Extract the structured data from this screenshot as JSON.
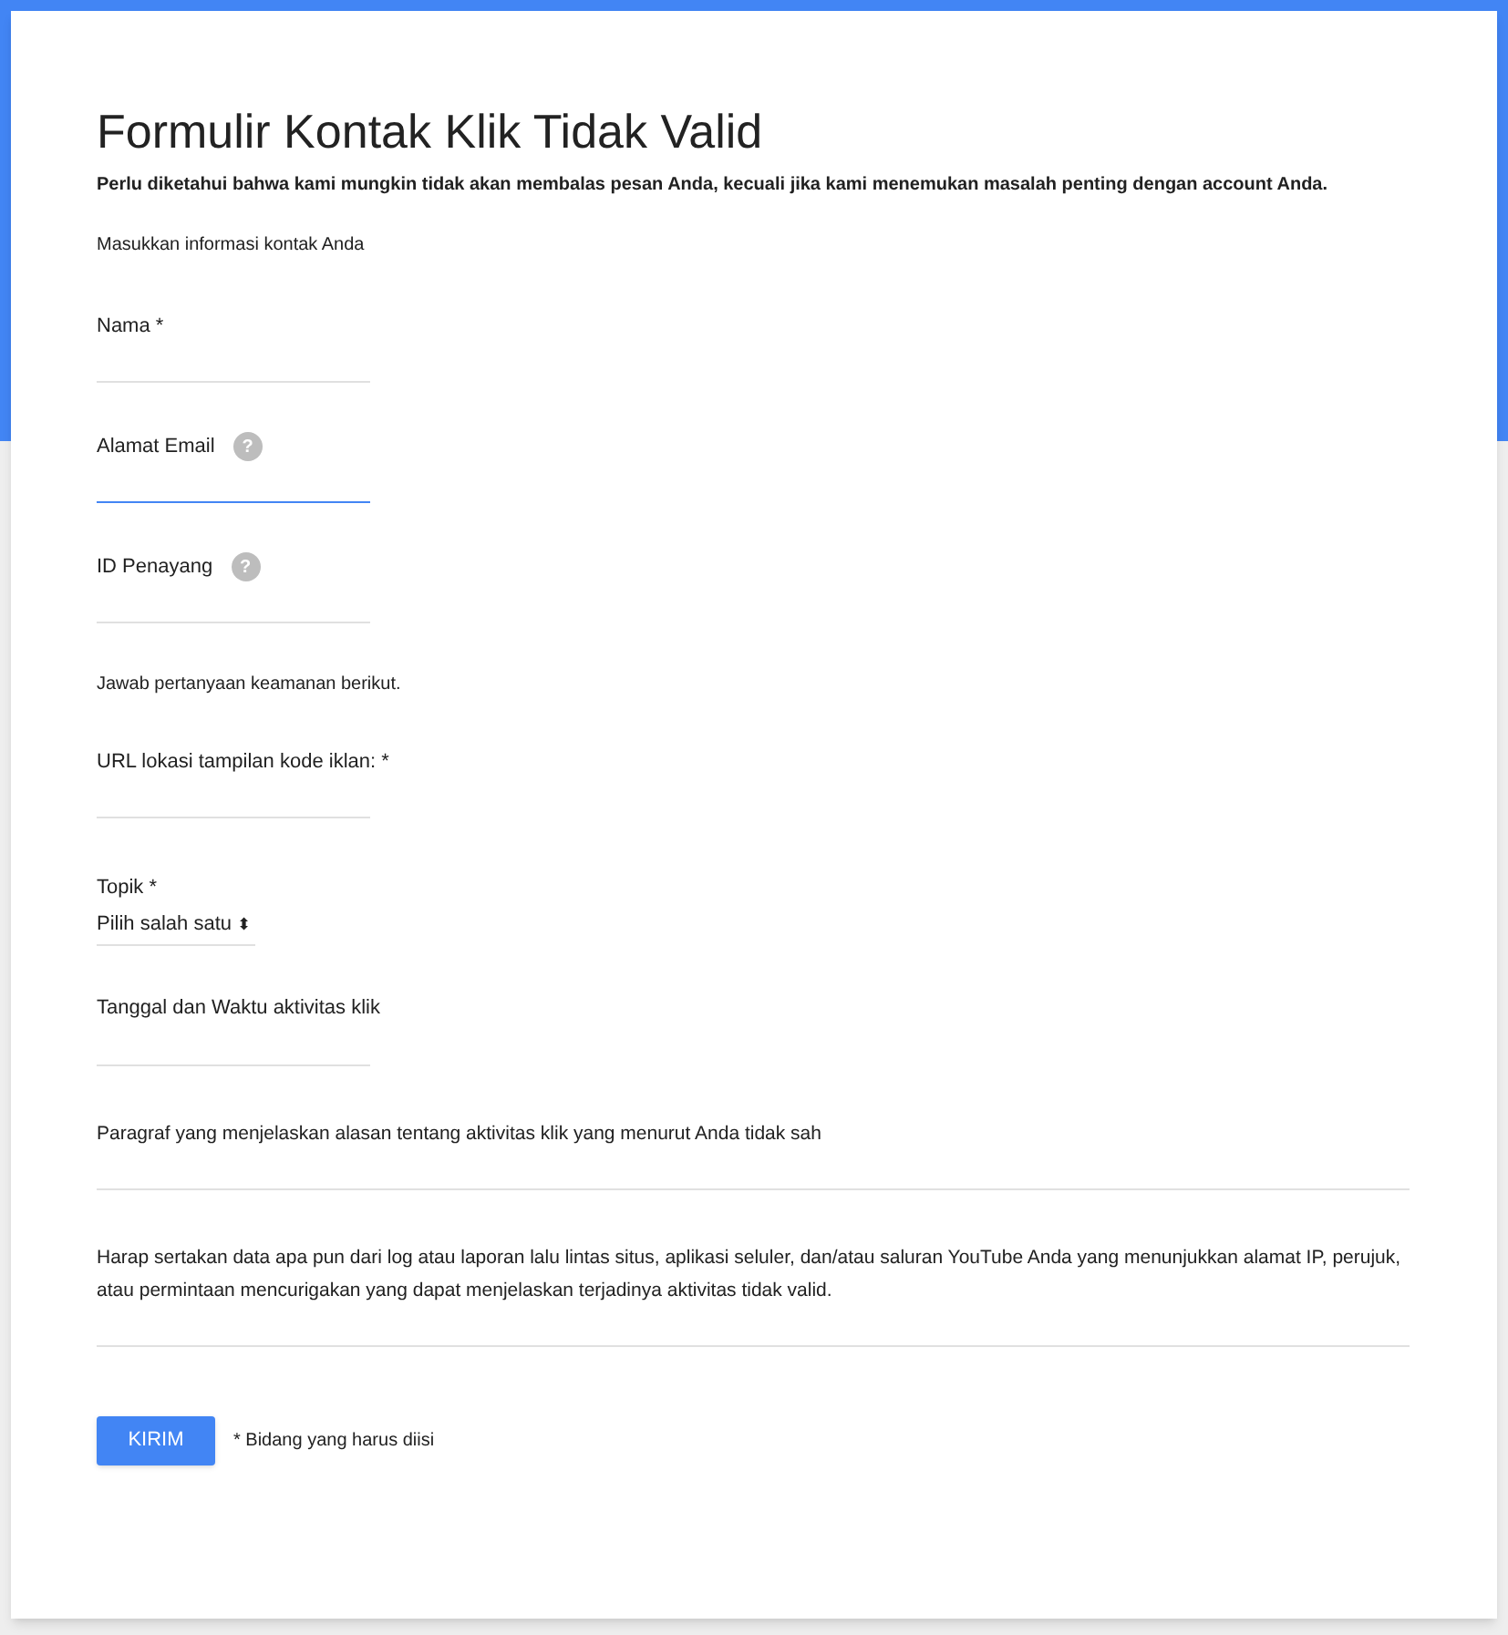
{
  "form": {
    "title": "Formulir Kontak Klik Tidak Valid",
    "notice": "Perlu diketahui bahwa kami mungkin tidak akan membalas pesan Anda, kecuali jika kami menemukan masalah penting dengan account Anda.",
    "items": [
      {
        "kind": "note",
        "text": "Masukkan informasi kontak Anda"
      },
      {
        "kind": "field",
        "label": "Nama *",
        "focused": false
      },
      {
        "kind": "field",
        "label": "Alamat Email",
        "help_icon": "?",
        "focused": true
      },
      {
        "kind": "field",
        "label": "ID Penayang",
        "help_icon": "?",
        "focused": false
      },
      {
        "kind": "note",
        "text": "Jawab pertanyaan keamanan berikut."
      },
      {
        "kind": "field",
        "label": "URL lokasi tampilan kode iklan: *",
        "focused": false
      },
      {
        "kind": "select",
        "label": "Topik *",
        "value": "Pilih salah satu",
        "arrow": "⬍"
      },
      {
        "kind": "field",
        "label": "Tanggal dan Waktu aktivitas klik",
        "focused": false
      },
      {
        "kind": "textarea",
        "label": "Paragraf yang menjelaskan alasan tentang aktivitas klik yang menurut Anda tidak sah"
      },
      {
        "kind": "textarea",
        "label": "Harap sertakan data apa pun dari log atau laporan lalu lintas situs, aplikasi seluler, dan/atau saluran YouTube Anda yang menunjukkan alamat IP, perujuk, atau permintaan mencurigakan yang dapat menjelaskan terjadinya aktivitas tidak valid."
      }
    ],
    "submit": "KIRIM",
    "required_note": "* Bidang yang harus diisi"
  }
}
